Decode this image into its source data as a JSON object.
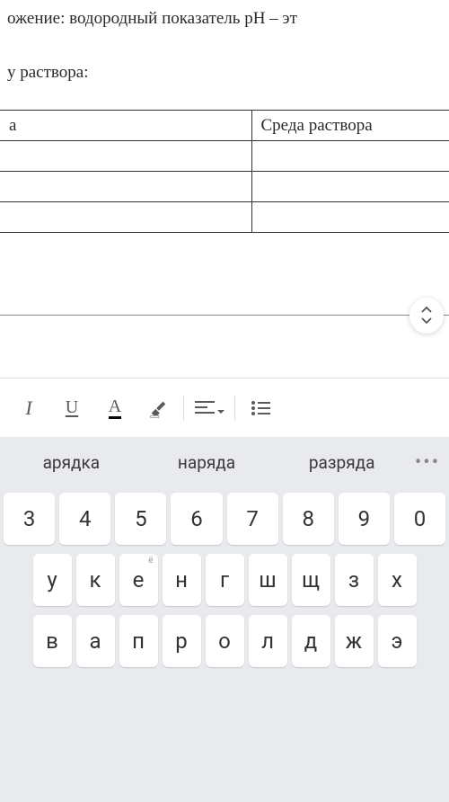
{
  "document": {
    "heading": "ожение: водородный показатель рН – эт",
    "subtext": "у раствора:",
    "table": {
      "headers": {
        "a": "а",
        "b": "Среда раствора"
      }
    }
  },
  "toolbar": {
    "italic": "I",
    "underline": "U",
    "textcolor": "A"
  },
  "keyboard": {
    "suggestions": [
      "арядка",
      "наряда",
      "разряда"
    ],
    "more": "•••",
    "row1": [
      "3",
      "4",
      "5",
      "6",
      "7",
      "8",
      "9",
      "0"
    ],
    "row2": [
      "у",
      "к",
      "е",
      "н",
      "г",
      "ш",
      "щ",
      "з",
      "х"
    ],
    "row2_hint": {
      "2": "ё"
    },
    "row3": [
      "в",
      "а",
      "п",
      "р",
      "о",
      "л",
      "д",
      "ж",
      "э"
    ]
  }
}
